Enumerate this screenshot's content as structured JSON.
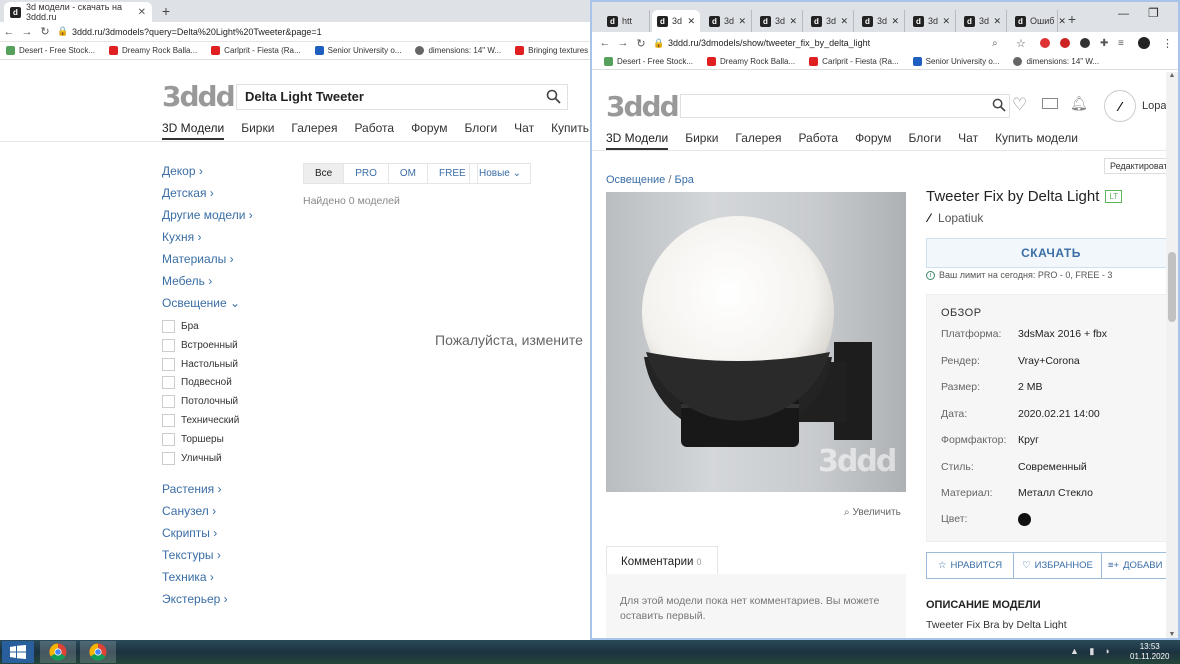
{
  "left_window": {
    "tab_title": "3d модели - скачать на 3ddd.ru",
    "url": "3ddd.ru/3dmodels?query=Delta%20Light%20Tweeter&page=1",
    "bookmarks": [
      "Desert - Free Stock...",
      "Dreamy Rock Balla...",
      "Carlprit - Fiesta (Ra...",
      "Senior University o...",
      "dimensions: 14\" W...",
      "Bringing textures in..."
    ],
    "logo": "3ddd",
    "search_value": "Delta Light Tweeter",
    "nav": [
      "3D Модели",
      "Бирки",
      "Галерея",
      "Работа",
      "Форум",
      "Блоги",
      "Чат",
      "Купить модели"
    ],
    "categories_top": [
      "Декор",
      "Детская",
      "Другие модели",
      "Кухня",
      "Материалы",
      "Мебель",
      "Освещение"
    ],
    "subcategories": [
      "Бра",
      "Встроенный",
      "Настольный",
      "Подвесной",
      "Потолочный",
      "Технический",
      "Торшеры",
      "Уличный"
    ],
    "categories_bottom": [
      "Растения",
      "Санузел",
      "Скрипты",
      "Текстуры",
      "Техника",
      "Экстерьер"
    ],
    "filters": [
      "Все",
      "PRO",
      "OM",
      "FREE"
    ],
    "sort_label": "Новые",
    "found_text": "Найдено 0 моделей",
    "empty_message": "Пожалуйста, измените"
  },
  "right_window": {
    "tabs": [
      "htt",
      "3d",
      "3d",
      "3d",
      "3d",
      "3d",
      "3d",
      "3d",
      "Ошиб"
    ],
    "url": "3ddd.ru/3dmodels/show/tweeter_fix_by_delta_light",
    "bookmarks": [
      "Desert - Free Stock...",
      "Dreamy Rock Balla...",
      "Carlprit - Fiesta (Ra...",
      "Senior University o...",
      "dimensions: 14\" W..."
    ],
    "logo": "3ddd",
    "user_name": "Lopa",
    "nav": [
      "3D Модели",
      "Бирки",
      "Галерея",
      "Работа",
      "Форум",
      "Блоги",
      "Чат",
      "Купить модели"
    ],
    "edit_label": "Редактировать",
    "breadcrumb": [
      "Освещение",
      "/",
      "Бра"
    ],
    "watermark": "3ddd",
    "zoom_label": "Увеличить",
    "model_title": "Tweeter Fix by Delta Light",
    "badge": "LT",
    "author": "Lopatiuk",
    "download_label": "СКАЧАТЬ",
    "limit_text": "Ваш лимит на сегодня: PRO - 0, FREE - 3",
    "overview_title": "ОБЗОР",
    "specs": [
      {
        "k": "Платформа:",
        "v": "3dsMax 2016 + fbx"
      },
      {
        "k": "Рендер:",
        "v": "Vray+Corona"
      },
      {
        "k": "Размер:",
        "v": "2 MB"
      },
      {
        "k": "Дата:",
        "v": "2020.02.21 14:00"
      },
      {
        "k": "Формфактор:",
        "v": "Круг"
      },
      {
        "k": "Стиль:",
        "v": "Современный"
      },
      {
        "k": "Материал:",
        "v": "Металл Стекло"
      },
      {
        "k": "Цвет:",
        "v": ""
      }
    ],
    "color_swatch": "#111111",
    "like_label": "НРАВИТСЯ",
    "fav_label": "ИЗБРАННОЕ",
    "add_label": "ДОБАВИ",
    "comments_tab": "Комментарии",
    "comments_count": "0",
    "no_comments": "Для этой модели пока нет комментариев. Вы можете оставить первый.",
    "description_title": "ОПИСАНИЕ МОДЕЛИ",
    "description_text": "Tweeter Fix Bra by Delta Light"
  },
  "taskbar": {
    "time": "13:53",
    "date": "01.11.2020"
  },
  "colors": {
    "link": "#3a6ea5",
    "accent_border": "#a9c4e8",
    "taskbar": "#1c3240"
  }
}
